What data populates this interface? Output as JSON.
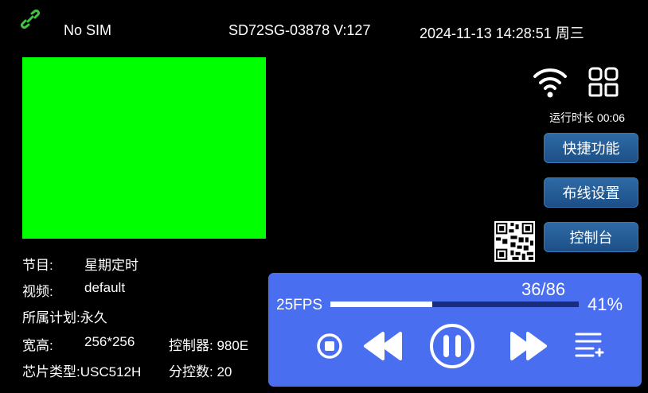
{
  "status_bar": {
    "sim": "No SIM",
    "device": "SD72SG-03878  V:127",
    "datetime": "2024-11-13  14:28:51  周三"
  },
  "runtime": "运行时长 00:06",
  "buttons": {
    "quick": "快捷功能",
    "wiring": "布线设置",
    "console": "控制台"
  },
  "info": {
    "program_label": "节目:",
    "program_value": "星期定时",
    "video_label": "视频:",
    "video_value": "default",
    "plan": "所属计划:永久",
    "size_label": "宽高:",
    "size_value": "256*256",
    "controller": "控制器: 980E",
    "chip": "芯片类型:USC512H",
    "sub_controls": "分控数: 20"
  },
  "player": {
    "fps": "25FPS",
    "count": "36/86",
    "percent": "41%",
    "progress": 0.41
  },
  "colors": {
    "preview": "#00ff00",
    "player_bg": "#4a6ef0",
    "button_bg": "#1f5590",
    "link_icon": "#3ec43e"
  },
  "icons": [
    "link-icon",
    "wifi-icon",
    "grid-icon",
    "qr-code-icon",
    "stop-icon",
    "rewind-icon",
    "pause-icon",
    "fast-forward-icon",
    "playlist-add-icon"
  ]
}
